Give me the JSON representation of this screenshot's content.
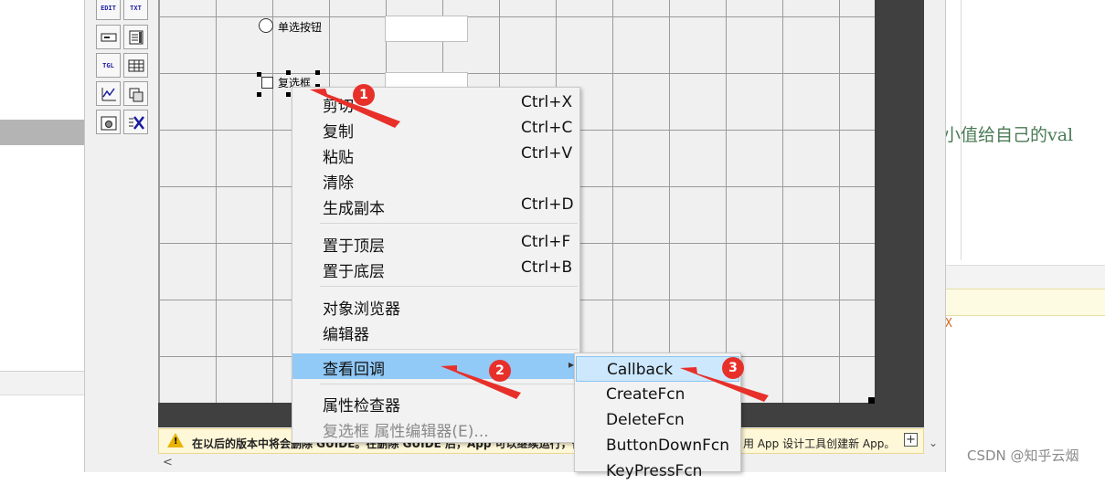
{
  "palette": {
    "buttons": [
      "EDIT",
      "TXT",
      "",
      "",
      "TGL",
      "",
      "",
      "",
      "",
      ""
    ]
  },
  "canvas": {
    "radio_label": "单选按钮",
    "checkbox_label": "复选框"
  },
  "context_menu": {
    "items": [
      {
        "label": "剪切",
        "shortcut": "Ctrl+X"
      },
      {
        "label": "复制",
        "shortcut": "Ctrl+C"
      },
      {
        "label": "粘贴",
        "shortcut": "Ctrl+V"
      },
      {
        "label": "清除",
        "shortcut": ""
      },
      {
        "label": "生成副本",
        "shortcut": "Ctrl+D"
      },
      {
        "label": "置于顶层",
        "shortcut": "Ctrl+F"
      },
      {
        "label": "置于底层",
        "shortcut": "Ctrl+B"
      },
      {
        "label": "对象浏览器",
        "shortcut": ""
      },
      {
        "label": "编辑器",
        "shortcut": ""
      },
      {
        "label": "查看回调",
        "shortcut": ""
      },
      {
        "label": "属性检查器",
        "shortcut": ""
      },
      {
        "label": "复选框 属性编辑器(E)...",
        "shortcut": ""
      }
    ]
  },
  "submenu": {
    "items": [
      "Callback",
      "CreateFcn",
      "DeleteFcn",
      "ButtonDownFcn",
      "KeyPressFcn"
    ]
  },
  "warning": {
    "text_left": "在以后的版本中将会删除 GUIDE。在删除 GUIDE 后，App 可以继续运行，但不",
    "text_right": "用 App 设计工具创建新 App。",
    "plus": "+"
  },
  "background": {
    "right_text": "较小值给自己的val",
    "right_x": "X",
    "watermark": "CSDN @知乎云烟"
  },
  "annotations": {
    "badges": [
      "1",
      "2",
      "3"
    ],
    "arrow_color": "#e8302a"
  },
  "colors": {
    "menu_highlight": "#91c9f7",
    "submenu_highlight": "#cde8fc",
    "warning_bg": "#fff8d8"
  }
}
